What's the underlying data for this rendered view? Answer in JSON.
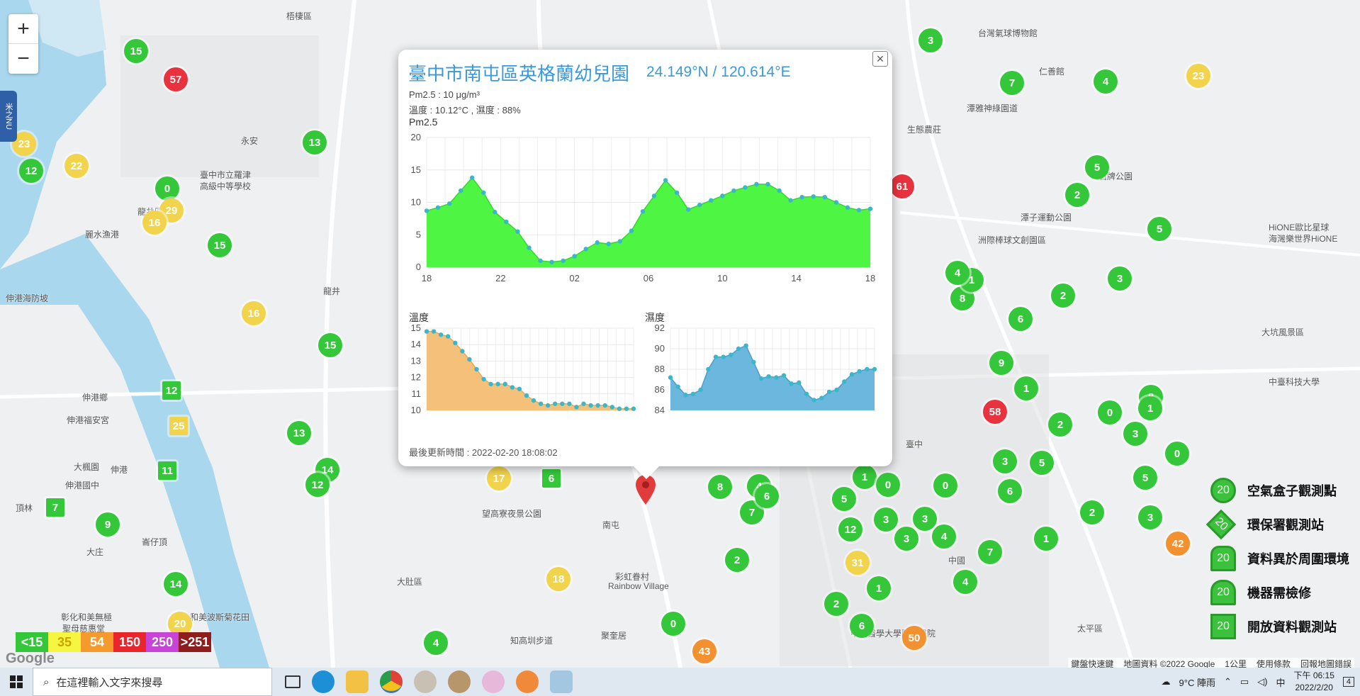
{
  "map": {
    "zoom_in": "+",
    "zoom_out": "−",
    "side_tab": "米之NU",
    "place_labels": [
      {
        "text": "梧棲區"
      },
      {
        "text": "永安"
      },
      {
        "text": "臺中市立羅津"
      },
      {
        "text": "高級中等學校"
      },
      {
        "text": "龍井區"
      },
      {
        "text": "麗水漁港"
      },
      {
        "text": "伸港海防坡"
      },
      {
        "text": "龍井"
      },
      {
        "text": "伸港鄉"
      },
      {
        "text": "伸港福安宮"
      },
      {
        "text": "伸港國中"
      },
      {
        "text": "大楓園"
      },
      {
        "text": "伸港"
      },
      {
        "text": "頂林"
      },
      {
        "text": "大庄"
      },
      {
        "text": "崙仔頂"
      },
      {
        "text": "彰化和美無極"
      },
      {
        "text": "聖母慈惠堂"
      },
      {
        "text": "和美波斯菊花田"
      },
      {
        "text": "大肚區"
      },
      {
        "text": "望高寮夜景公園"
      },
      {
        "text": "南屯"
      },
      {
        "text": "彩虹眷村"
      },
      {
        "text": "Rainbow Village"
      },
      {
        "text": "聚奎居"
      },
      {
        "text": "知高圳步道"
      },
      {
        "text": "台灣氣球博物館"
      },
      {
        "text": "仁善館"
      },
      {
        "text": "潭雅神綠園道"
      },
      {
        "text": "生態農莊"
      },
      {
        "text": "石牌公園"
      },
      {
        "text": "潭子運動公園"
      },
      {
        "text": "洲際棒球文創園區"
      },
      {
        "text": "HiONE歐比星球"
      },
      {
        "text": "海灣樂世界HiONE"
      },
      {
        "text": "大坑風景區"
      },
      {
        "text": "中臺科技大學"
      },
      {
        "text": "臺中"
      },
      {
        "text": "中山醫學大學附設醫院"
      },
      {
        "text": "太平區"
      },
      {
        "text": "中國"
      }
    ],
    "markers": [
      {
        "v": "57",
        "c": "#e8323e"
      },
      {
        "v": "15",
        "c": "#35c73a"
      },
      {
        "v": "23",
        "c": "#f1d34c"
      },
      {
        "v": "12",
        "c": "#35c73a"
      },
      {
        "v": "22",
        "c": "#f1d34c"
      },
      {
        "v": "13",
        "c": "#35c73a"
      },
      {
        "v": "0",
        "c": "#35c73a"
      },
      {
        "v": "29",
        "c": "#f1d34c"
      },
      {
        "v": "16",
        "c": "#f1d34c"
      },
      {
        "v": "15",
        "c": "#35c73a"
      },
      {
        "v": "16",
        "c": "#f1d34c"
      },
      {
        "v": "15",
        "c": "#35c73a"
      },
      {
        "v": "12",
        "c": "#35c73a"
      },
      {
        "v": "25",
        "c": "#f1d34c"
      },
      {
        "v": "13",
        "c": "#35c73a"
      },
      {
        "v": "14",
        "c": "#35c73a"
      },
      {
        "v": "12",
        "c": "#35c73a"
      },
      {
        "v": "11",
        "c": "#35c73a"
      },
      {
        "v": "7",
        "c": "#35c73a"
      },
      {
        "v": "9",
        "c": "#35c73a"
      },
      {
        "v": "14",
        "c": "#35c73a"
      },
      {
        "v": "20",
        "c": "#f1d34c"
      },
      {
        "v": "4",
        "c": "#35c73a"
      },
      {
        "v": "17",
        "c": "#f1d34c"
      },
      {
        "v": "6",
        "c": "#35c73a"
      },
      {
        "v": "18",
        "c": "#f1d34c"
      },
      {
        "v": "0",
        "c": "#35c73a"
      },
      {
        "v": "43",
        "c": "#f3902f"
      },
      {
        "v": "61",
        "c": "#e8323e"
      },
      {
        "v": "58",
        "c": "#e8323e"
      },
      {
        "v": "23",
        "c": "#f1d34c"
      },
      {
        "v": "31",
        "c": "#f1d34c"
      },
      {
        "v": "50",
        "c": "#f3902f"
      },
      {
        "v": "42",
        "c": "#f3902f"
      },
      {
        "v": "3",
        "c": "#35c73a"
      },
      {
        "v": "4",
        "c": "#35c73a"
      },
      {
        "v": "7",
        "c": "#35c73a"
      },
      {
        "v": "5",
        "c": "#35c73a"
      },
      {
        "v": "2",
        "c": "#35c73a"
      },
      {
        "v": "8",
        "c": "#35c73a"
      },
      {
        "v": "1",
        "c": "#35c73a"
      },
      {
        "v": "6",
        "c": "#35c73a"
      },
      {
        "v": "9",
        "c": "#35c73a"
      },
      {
        "v": "3",
        "c": "#35c73a"
      },
      {
        "v": "5",
        "c": "#35c73a"
      },
      {
        "v": "2",
        "c": "#35c73a"
      },
      {
        "v": "4",
        "c": "#35c73a"
      },
      {
        "v": "1",
        "c": "#35c73a"
      },
      {
        "v": "0",
        "c": "#35c73a"
      },
      {
        "v": "3",
        "c": "#35c73a"
      },
      {
        "v": "6",
        "c": "#35c73a"
      },
      {
        "v": "2",
        "c": "#35c73a"
      },
      {
        "v": "5",
        "c": "#35c73a"
      },
      {
        "v": "8",
        "c": "#35c73a"
      },
      {
        "v": "4",
        "c": "#35c73a"
      },
      {
        "v": "7",
        "c": "#35c73a"
      },
      {
        "v": "1",
        "c": "#35c73a"
      },
      {
        "v": "3",
        "c": "#35c73a"
      },
      {
        "v": "12",
        "c": "#35c73a"
      },
      {
        "v": "6",
        "c": "#35c73a"
      },
      {
        "v": "2",
        "c": "#35c73a"
      },
      {
        "v": "0",
        "c": "#35c73a"
      },
      {
        "v": "5",
        "c": "#35c73a"
      },
      {
        "v": "3",
        "c": "#35c73a"
      },
      {
        "v": "4",
        "c": "#35c73a"
      },
      {
        "v": "1",
        "c": "#35c73a"
      },
      {
        "v": "2",
        "c": "#35c73a"
      },
      {
        "v": "6",
        "c": "#35c73a"
      },
      {
        "v": "3",
        "c": "#35c73a"
      },
      {
        "v": "7",
        "c": "#35c73a"
      },
      {
        "v": "0",
        "c": "#35c73a"
      },
      {
        "v": "4",
        "c": "#35c73a"
      },
      {
        "v": "1",
        "c": "#35c73a"
      },
      {
        "v": "3",
        "c": "#35c73a"
      },
      {
        "v": "5",
        "c": "#35c73a"
      },
      {
        "v": "2",
        "c": "#35c73a"
      },
      {
        "v": "8",
        "c": "#35c73a"
      },
      {
        "v": "0",
        "c": "#35c73a"
      },
      {
        "v": "1",
        "c": "#35c73a"
      },
      {
        "v": "3",
        "c": "#35c73a"
      }
    ]
  },
  "popup": {
    "title": "臺中市南屯區英格蘭幼兒園",
    "coords": "24.149°N / 120.614°E",
    "pm25_line": "Pm2.5 : 10 μg/m³",
    "temp_line": "溫度 : 10.12°C , 濕度 : 88%",
    "close": "×",
    "updated": "最後更新時間 : 2022-02-20 18:08:02",
    "colors": {
      "pm25": "#4ef542",
      "temp": "#f5c07a",
      "hum": "#6bb7de",
      "point": "#3ab7c9"
    }
  },
  "chart_data": [
    {
      "type": "area",
      "title": "Pm2.5",
      "xticks": [
        "18",
        "22",
        "02",
        "06",
        "10",
        "14",
        "18"
      ],
      "yticks": [
        0,
        5,
        10,
        15,
        20
      ],
      "ylim": [
        0,
        20
      ],
      "grid": true,
      "values": [
        8.7,
        9.2,
        9.8,
        11.8,
        13.8,
        11.5,
        8.5,
        7.0,
        5.5,
        3.0,
        1.0,
        0.8,
        1.0,
        1.7,
        2.8,
        3.8,
        3.6,
        4.0,
        5.6,
        8.6,
        11.0,
        13.4,
        11.5,
        8.9,
        9.6,
        10.3,
        11.0,
        11.8,
        12.3,
        12.8,
        12.8,
        11.8,
        10.3,
        10.8,
        10.9,
        10.8,
        10.0,
        9.2,
        8.8,
        9.0
      ]
    },
    {
      "type": "area",
      "title": "溫度",
      "yticks": [
        10,
        11,
        12,
        13,
        14,
        15
      ],
      "ylim": [
        10,
        15
      ],
      "grid": true,
      "values": [
        14.8,
        14.8,
        14.6,
        14.5,
        14.1,
        13.6,
        13.1,
        12.5,
        11.9,
        11.6,
        11.6,
        11.6,
        11.4,
        11.3,
        10.9,
        10.6,
        10.4,
        10.3,
        10.4,
        10.4,
        10.4,
        10.2,
        10.4,
        10.3,
        10.3,
        10.3,
        10.2,
        10.1,
        10.1,
        10.1
      ]
    },
    {
      "type": "area",
      "title": "濕度",
      "yticks": [
        84,
        86,
        88,
        90,
        92
      ],
      "ylim": [
        84,
        92
      ],
      "grid": true,
      "values": [
        87.2,
        86.3,
        85.5,
        85.6,
        86.0,
        88.0,
        89.2,
        89.2,
        89.4,
        90.0,
        90.3,
        88.7,
        87.1,
        87.3,
        87.2,
        87.4,
        86.6,
        86.7,
        85.6,
        85.0,
        85.2,
        85.8,
        86.0,
        86.8,
        87.5,
        87.8,
        88.0,
        88.0
      ]
    }
  ],
  "legend_scale": [
    {
      "label": "<15",
      "c": "#35c73a"
    },
    {
      "label": "35",
      "c": "#f5f542"
    },
    {
      "label": "54",
      "c": "#f59a2c"
    },
    {
      "label": "150",
      "c": "#e8262c"
    },
    {
      "label": "250",
      "c": "#c744d6"
    },
    {
      "label": ">251",
      "c": "#8e1d1d"
    }
  ],
  "legend_right": [
    {
      "ic": "20",
      "label": "空氣盒子觀測點",
      "shape": "circle"
    },
    {
      "ic": "20",
      "label": "環保署觀測站",
      "shape": "diamond"
    },
    {
      "ic": "20",
      "label": "資料異於周圍環境",
      "shape": "house"
    },
    {
      "ic": "20",
      "label": "機器需檢修",
      "shape": "triangle"
    },
    {
      "ic": "20",
      "label": "開放資料觀測站",
      "shape": "square"
    }
  ],
  "attribution": [
    "鍵盤快速鍵",
    "地圖資料 ©2022 Google",
    "1公里",
    "使用條款",
    "回報地圖錯誤"
  ],
  "google_mark": "Google",
  "taskbar": {
    "search_placeholder": "在這裡輸入文字來搜尋",
    "weather": "9°C  陣雨",
    "ime": "中",
    "time": "下午 06:15",
    "date": "2022/2/20",
    "notif": "4"
  }
}
